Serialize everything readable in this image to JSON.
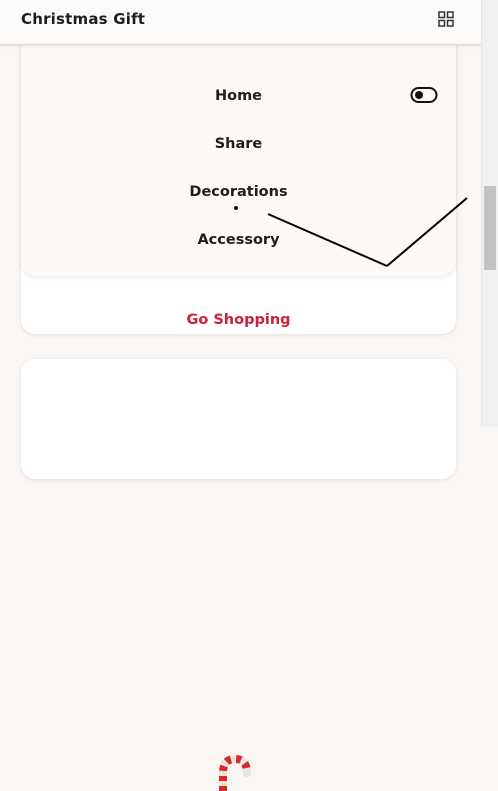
{
  "header": {
    "title": "Christmas Gift",
    "menu_icon": "grid-icon"
  },
  "menu": {
    "items": [
      {
        "label": "Home"
      },
      {
        "label": "Share"
      },
      {
        "label": "Decorations"
      },
      {
        "label": "Accessory"
      }
    ],
    "toggle_icon": "toggle-switch-icon"
  },
  "card": {
    "action_label": "Go Shopping"
  },
  "product_card": {
    "image_icon": "candy-cane-icon"
  },
  "colors": {
    "accent": "#d01f38",
    "background": "#faf6f4",
    "menu_background": "#fcf9f7"
  }
}
